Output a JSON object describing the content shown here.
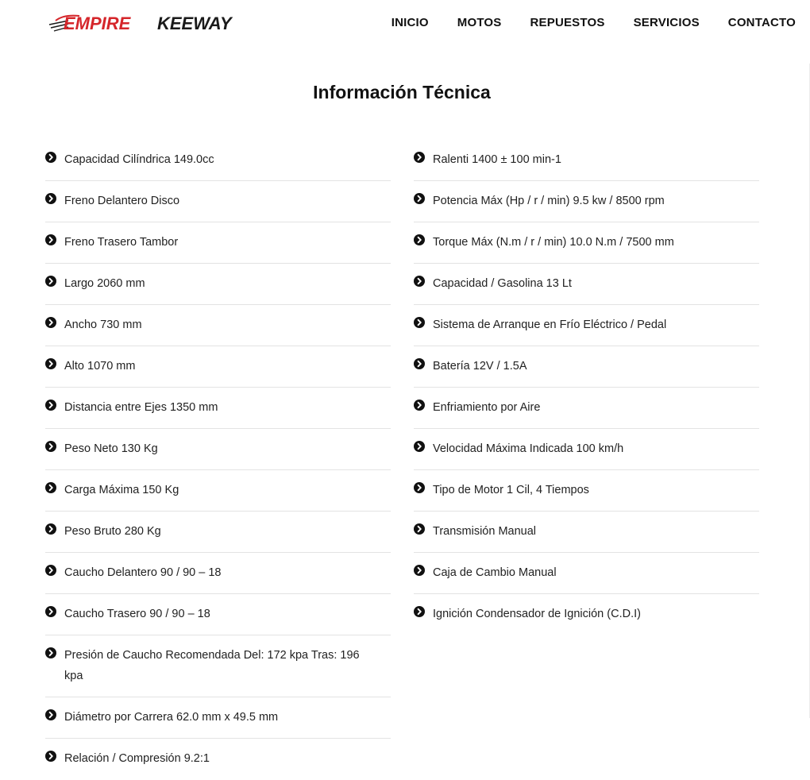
{
  "brand": {
    "logo_text_1": "EMPIRE",
    "logo_text_2": "KEEWAY",
    "accent_red": "#d5262b",
    "dark": "#1a1a1a"
  },
  "nav": {
    "items": [
      "INICIO",
      "MOTOS",
      "REPUESTOS",
      "SERVICIOS",
      "CONTACTO"
    ]
  },
  "title": "Información Técnica",
  "icons": {
    "bullet": "chevron-circle-right-icon"
  },
  "specs_left": [
    "Capacidad Cilíndrica 149.0cc",
    "Freno Delantero Disco",
    "Freno Trasero Tambor",
    "Largo 2060 mm",
    "Ancho 730 mm",
    "Alto 1070 mm",
    "Distancia entre Ejes 1350 mm",
    "Peso Neto 130 Kg",
    "Carga Máxima 150 Kg",
    "Peso Bruto 280 Kg",
    "Caucho Delantero 90 / 90 – 18",
    "Caucho Trasero 90 / 90 – 18",
    "Presión de Caucho Recomendada Del: 172 kpa Tras: 196 kpa",
    "Diámetro por Carrera 62.0 mm x 49.5 mm",
    "Relación / Compresión 9.2:1"
  ],
  "specs_right": [
    "Ralenti 1400 ± 100 min-1",
    "Potencia Máx (Hp / r / min) 9.5 kw / 8500 rpm",
    "Torque Máx (N.m / r / min) 10.0 N.m / 7500 mm",
    "Capacidad / Gasolina 13 Lt",
    "Sistema de Arranque en Frío Eléctrico / Pedal",
    "Batería 12V / 1.5A",
    "Enfriamiento por Aire",
    "Velocidad Máxima Indicada 100 km/h",
    "Tipo de Motor 1 Cil, 4 Tiempos",
    "Transmisión Manual",
    "Caja de Cambio Manual",
    "Ignición Condensador de Ignición (C.D.I)"
  ]
}
